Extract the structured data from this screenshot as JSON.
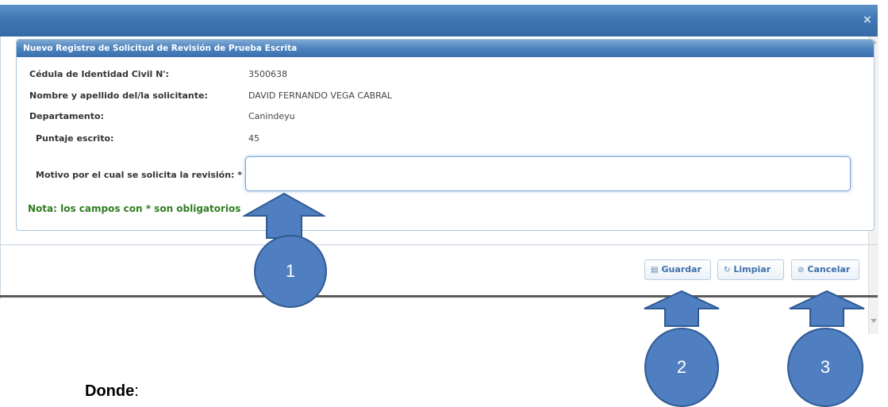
{
  "modal": {
    "close_glyph": "×",
    "panel_title": "Nuevo Registro de Solicitud de Revisión de Prueba Escrita"
  },
  "fields": [
    {
      "label": "Cédula de Identidad Civil N':",
      "value": "3500638"
    },
    {
      "label": "Nombre y apellido del/la solicitante:",
      "value": "DAVID FERNANDO VEGA CABRAL"
    },
    {
      "label": "Departamento:",
      "value": "Canindeyu"
    },
    {
      "label": "Puntaje escrito:",
      "value": "45"
    }
  ],
  "motivo": {
    "label": "Motivo por el cual se solicita la revisión: *",
    "value": ""
  },
  "nota": "Nota: los campos con * son obligatorios",
  "buttons": {
    "guardar": {
      "label": "Guardar",
      "icon": "save-icon"
    },
    "limpiar": {
      "label": "Limpiar",
      "icon": "refresh-icon"
    },
    "cancelar": {
      "label": "Cancelar",
      "icon": "cancel-icon"
    }
  },
  "annotations": {
    "one": "1",
    "two": "2",
    "three": "3"
  },
  "caption": {
    "word": "Donde",
    "punct": ":"
  },
  "colors": {
    "header_blue": "#3f76b4",
    "nota_green": "#2e7d1f",
    "annotation_blue": "#4f7fc0"
  }
}
